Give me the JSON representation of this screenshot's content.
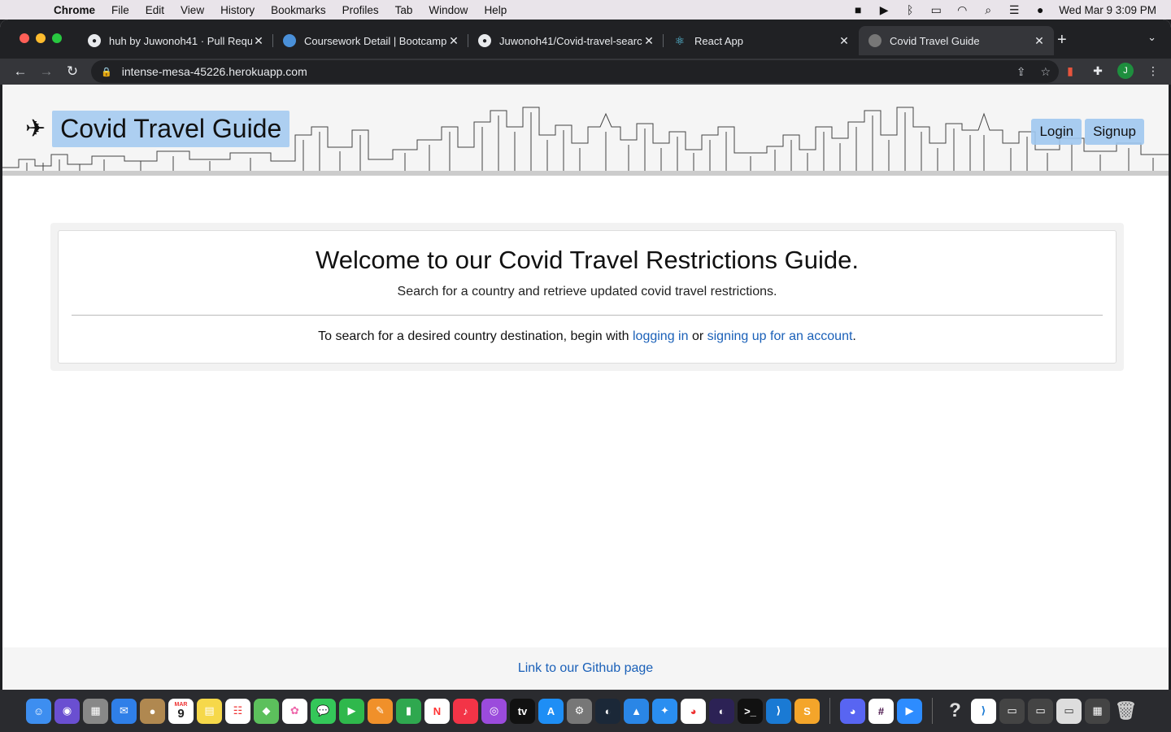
{
  "menubar": {
    "app_name": "Chrome",
    "items": [
      "File",
      "Edit",
      "View",
      "History",
      "Bookmarks",
      "Profiles",
      "Tab",
      "Window",
      "Help"
    ],
    "clock": "Wed Mar 9  3:09 PM"
  },
  "tabs": [
    {
      "title": "huh by Juwonoh41 · Pull Reque",
      "icon": "github-icon",
      "active": false
    },
    {
      "title": "Coursework Detail | Bootcamp",
      "icon": "globe-icon",
      "active": false
    },
    {
      "title": "Juwonoh41/Covid-travel-searc",
      "icon": "github-icon",
      "active": false
    },
    {
      "title": "React App",
      "icon": "react-icon",
      "active": false
    },
    {
      "title": "Covid Travel Guide",
      "icon": "page-icon",
      "active": true
    }
  ],
  "address": {
    "url": "intense-mesa-45226.herokuapp.com"
  },
  "profile_initial": "J",
  "page": {
    "brand": "Covid Travel Guide",
    "login": "Login",
    "signup": "Signup",
    "heading": "Welcome to our Covid Travel Restrictions Guide.",
    "lead": "Search for a country and retrieve updated covid travel restrictions.",
    "cta_prefix": "To search for a desired country destination, begin with ",
    "cta_login": "logging in",
    "cta_middle": " or ",
    "cta_signup": "signing up for an account",
    "cta_suffix": ".",
    "footer_link": "Link to our Github page"
  },
  "dock": {
    "calendar_day": "9",
    "calendar_month": "MAR"
  }
}
